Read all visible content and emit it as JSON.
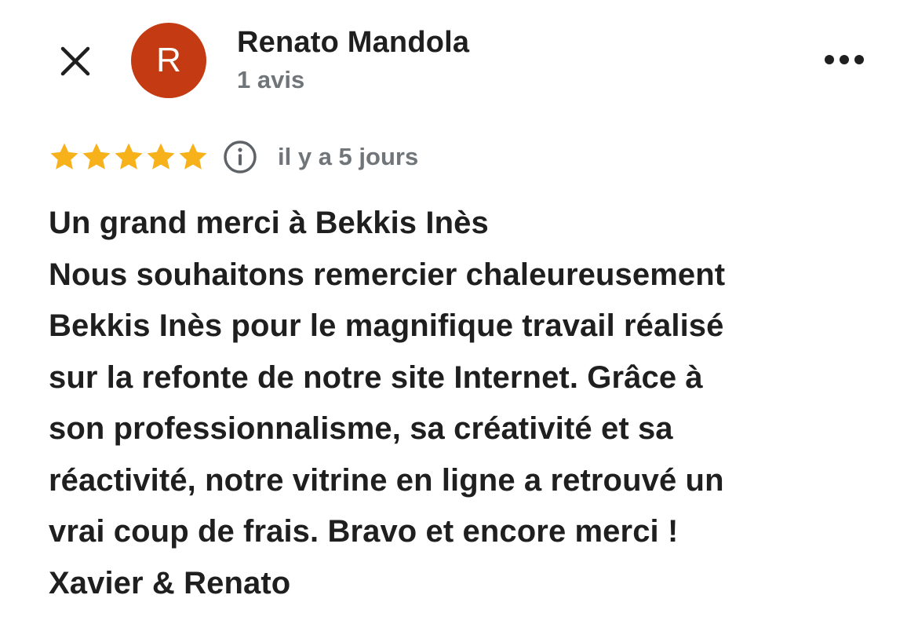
{
  "header": {
    "author_initial": "R",
    "author_name": "Renato Mandola",
    "review_count": "1 avis",
    "avatar_color": "#c43a12"
  },
  "rating": {
    "stars": 5,
    "max_stars": 5,
    "star_color": "#f6b11b",
    "date": "il y a 5 jours"
  },
  "icons": {
    "close": "close-icon",
    "more": "more-options-icon",
    "info": "info-icon",
    "star": "star-icon"
  },
  "review": {
    "lines": [
      "Un grand merci à Bekkis Inès",
      "Nous souhaitons remercier chaleureusement",
      "Bekkis Inès pour le magnifique travail réalisé",
      "sur la refonte de notre site Internet. Grâce à",
      "son professionnalisme, sa créativité et sa",
      "réactivité, notre vitrine en ligne a retrouvé un",
      "vrai coup de frais. Bravo et encore merci !",
      "Xavier & Renato"
    ]
  }
}
